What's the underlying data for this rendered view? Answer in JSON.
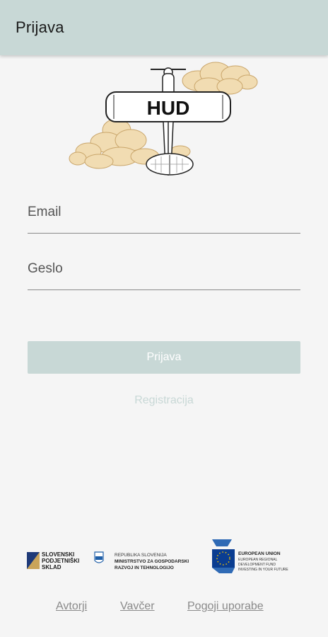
{
  "appbar": {
    "title": "Prijava"
  },
  "logo": {
    "text": "HUD"
  },
  "form": {
    "email_placeholder": "Email",
    "password_placeholder": "Geslo",
    "login_label": "Prijava",
    "register_label": "Registracija"
  },
  "sponsors": {
    "spirit_lines": [
      "SLOVENSKI",
      "PODJETNIŠKI",
      "SKLAD"
    ],
    "ministry_lines": [
      "REPUBLIKA SLOVENIJA",
      "MINISTRSTVO ZA GOSPODARSKI",
      "RAZVOJ IN TEHNOLOGIJO"
    ],
    "eu_lines": [
      "EUROPEAN UNION",
      "EUROPEAN REGIONAL",
      "DEVELOPMENT FUND",
      "INVESTING IN YOUR FUTURE"
    ]
  },
  "footer": {
    "authors": "Avtorji",
    "vavcer": "Vavčer",
    "terms": "Pogoji uporabe"
  },
  "colors": {
    "appbar": "#c8d8d6",
    "accent_disabled": "#c8d8d6",
    "background": "#f5f5f5"
  }
}
